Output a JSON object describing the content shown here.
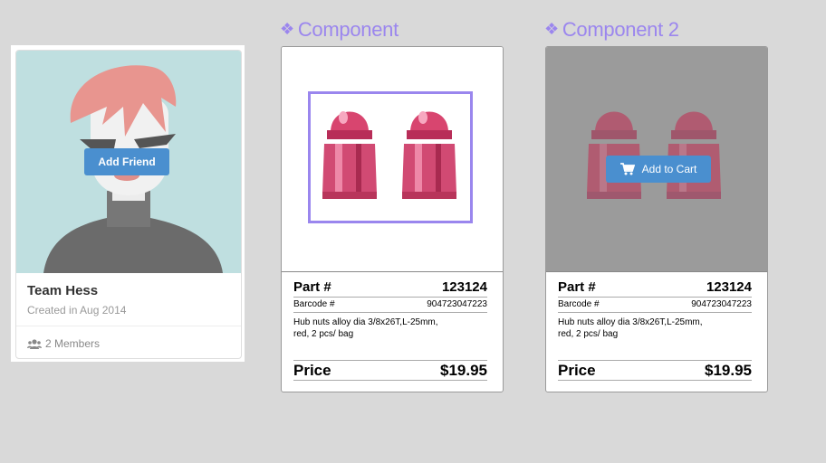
{
  "team_card": {
    "name": "Team Hess",
    "created": "Created in Aug 2014",
    "add_friend_label": "Add Friend",
    "members": "2 Members",
    "members_icon": "users-icon"
  },
  "components": [
    {
      "heading": "Component",
      "heading_icon": "❖",
      "part_label": "Part #",
      "part_number": "123124",
      "barcode_label": "Barcode #",
      "barcode": "904723047223",
      "description_line1": "Hub nuts alloy dia 3/8x26T,L-25mm,",
      "description_line2": "red, 2 pcs/ bag",
      "price_label": "Price",
      "price": "$19.95"
    },
    {
      "heading": "Component 2",
      "heading_icon": "❖",
      "add_to_cart_label": "Add to Cart",
      "cart_icon": "shopping-cart-icon",
      "part_label": "Part #",
      "part_number": "123124",
      "barcode_label": "Barcode #",
      "barcode": "904723047223",
      "description_line1": "Hub nuts alloy dia 3/8x26T,L-25mm,",
      "description_line2": "red, 2 pcs/ bag",
      "price_label": "Price",
      "price": "$19.95"
    }
  ],
  "colors": {
    "page_background": "#d9d9d9",
    "accent_purple": "#9b86ee",
    "button_blue": "#4a8fcf",
    "avatar_background": "#bfdfe0"
  }
}
